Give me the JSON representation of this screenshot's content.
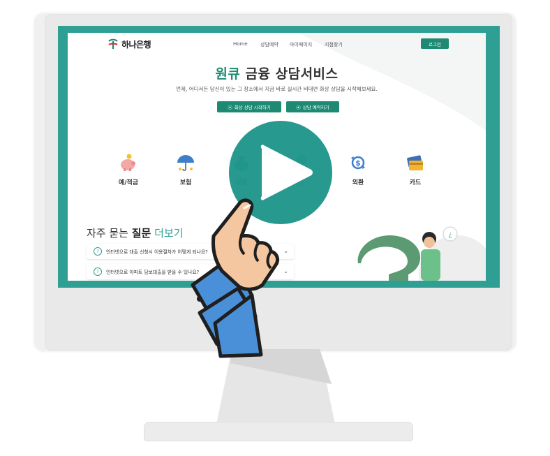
{
  "logo": {
    "text": "하나은행"
  },
  "nav": {
    "items": [
      "Home",
      "상담예약",
      "마이페이지",
      "지점찾기"
    ],
    "login_label": "로그인"
  },
  "hero": {
    "title_prefix": "원큐",
    "title_rest": "금융 상담서비스",
    "subtitle": "언제, 어디서든 당신이 있는 그 장소에서 지금 바로 실시간 비대면 화상 상담을 시작해보세요.",
    "start_button": "화상 상담 시작하기",
    "reserve_button": "상담 예약하기"
  },
  "services": [
    {
      "label": "예/적금",
      "icon": "piggy-bank-icon"
    },
    {
      "label": "보험",
      "icon": "umbrella-icon"
    },
    {
      "label": "대출",
      "icon": "money-bag-icon"
    },
    {
      "label": "펀드",
      "icon": "fund-icon"
    },
    {
      "label": "외환",
      "icon": "currency-exchange-icon"
    },
    {
      "label": "카드",
      "icon": "credit-card-icon"
    }
  ],
  "faq": {
    "title_plain": "자주 묻는",
    "title_bold": "질문",
    "title_more": "더보기",
    "items": [
      "인터넷으로 대출 신청시 이용절차가 어떻게 되나요?",
      "인터넷으로 아파트 담보대출을 받을 수 있나요?"
    ]
  },
  "colors": {
    "brand": "#1e8a73",
    "bezel": "#2f9f93",
    "play": "#20968a",
    "sleeve": "#4a90d9",
    "skin": "#f4c7a1"
  }
}
